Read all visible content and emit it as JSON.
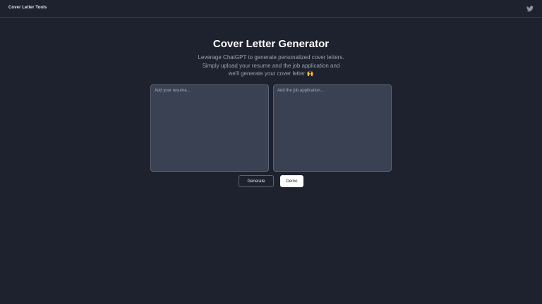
{
  "header": {
    "brand": "Cover Letter Tools",
    "social_icon": "twitter-icon"
  },
  "main": {
    "title": "Cover Letter Generator",
    "subtitle_lines": [
      "Leverage ChatGPT to generate personalized cover letters.",
      "Simply upload your resume and the job application and",
      "we'll generate your cover letter"
    ],
    "subtitle_emoji": "🙌",
    "resume_input": {
      "value": "",
      "placeholder": "Add your resume..."
    },
    "job_input": {
      "value": "",
      "placeholder": "Add the job application..."
    },
    "generate_label": "Generate",
    "demo_label": "Demo"
  },
  "colors": {
    "background": "#1e222e",
    "panel": "#394152",
    "border": "#5b6475",
    "muted_text": "#9aa1ad"
  }
}
